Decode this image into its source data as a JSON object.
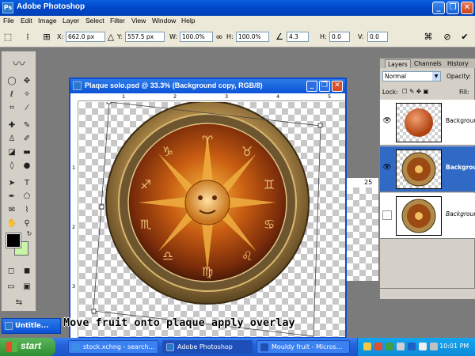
{
  "window": {
    "title": "Adobe Photoshop",
    "logo": "Ps",
    "minimize": "_",
    "restore": "❐",
    "close": "✕"
  },
  "menu": [
    "File",
    "Edit",
    "Image",
    "Layer",
    "Select",
    "Filter",
    "View",
    "Window",
    "Help"
  ],
  "options": {
    "x_label": "X:",
    "x_value": "662.0 px",
    "y_label": "Y:",
    "y_value": "557.5 px",
    "w_label": "W:",
    "w_value": "100.0%",
    "h_label": "H:",
    "h_value": "100.0%",
    "angle_value": "4.3",
    "hskew_label": "H:",
    "hskew_value": "0.0",
    "vskew_label": "V:",
    "vskew_value": "0.0"
  },
  "document": {
    "title": "Plaque solo.psd @ 33.3% (Background copy, RGB/8)",
    "ruler_top": [
      "1",
      "2",
      "3",
      "4",
      "5"
    ],
    "ruler_left": [
      "1",
      "2",
      "3"
    ]
  },
  "second_doc": {
    "ruler_label": "25"
  },
  "layers": {
    "tabs": [
      "Layers",
      "Channels",
      "History"
    ],
    "blend_mode": "Normal",
    "opacity_label": "Opacity:",
    "lock_label": "Lock:",
    "fill_label": "Fill:",
    "items": [
      {
        "name": "Background",
        "visible": true,
        "selected": false
      },
      {
        "name": "Background",
        "visible": true,
        "selected": true
      },
      {
        "name": "Background",
        "visible": false,
        "selected": false
      }
    ]
  },
  "minimized_window": {
    "title": "Untitle..."
  },
  "caption": "Move fruit onto plaque apply overlay",
  "taskbar": {
    "start": "start",
    "tasks": [
      {
        "label": "stock.xchng - search...",
        "active": false
      },
      {
        "label": "Adobe Photoshop",
        "active": true
      },
      {
        "label": "Mouldy fruit - Micros...",
        "active": false
      }
    ],
    "clock": "10:01 PM"
  },
  "colors": {
    "foreground": "#000000",
    "background": "#c7f5a5",
    "titlebar": "#0046c8",
    "selection": "#316ac5"
  }
}
